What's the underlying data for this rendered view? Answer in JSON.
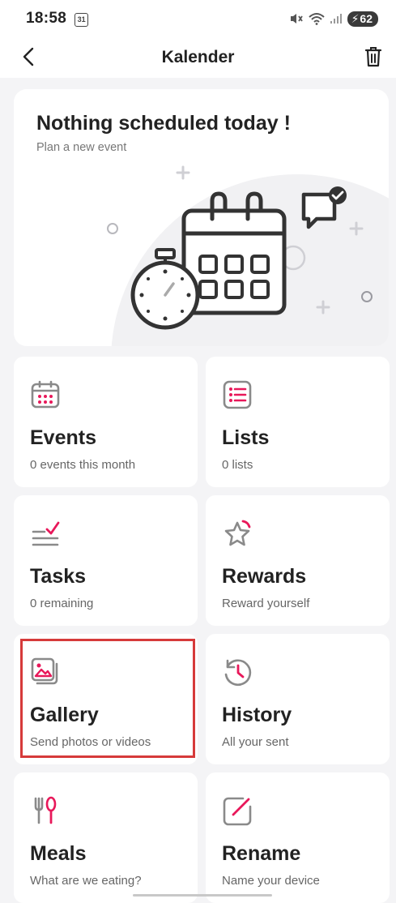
{
  "status_bar": {
    "time": "18:58",
    "calendar_badge": "31",
    "battery": "62"
  },
  "app_bar": {
    "title": "Kalender"
  },
  "hero": {
    "title": "Nothing scheduled today !",
    "subtitle": "Plan a new event"
  },
  "tiles": [
    {
      "title": "Events",
      "subtitle": "0 events this month",
      "icon": "calendar-icon"
    },
    {
      "title": "Lists",
      "subtitle": "0 lists",
      "icon": "list-icon"
    },
    {
      "title": "Tasks",
      "subtitle": "0 remaining",
      "icon": "tasks-icon"
    },
    {
      "title": "Rewards",
      "subtitle": "Reward yourself",
      "icon": "star-icon"
    },
    {
      "title": "Gallery",
      "subtitle": "Send photos or videos",
      "icon": "gallery-icon"
    },
    {
      "title": "History",
      "subtitle": "All your sent",
      "icon": "history-icon"
    },
    {
      "title": "Meals",
      "subtitle": "What are we eating?",
      "icon": "meals-icon"
    },
    {
      "title": "Rename",
      "subtitle": "Name your device",
      "icon": "rename-icon"
    }
  ],
  "colors": {
    "accent": "#e8185a",
    "icon_gray": "#8a8a8a",
    "highlight": "#d63a3a"
  }
}
